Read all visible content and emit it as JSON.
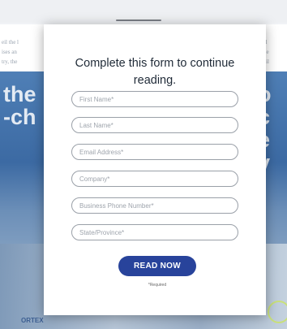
{
  "background": {
    "text_left": "eil the l\nises an\ntry, the",
    "text_right": "w sl\nlable\npabil",
    "headline_left": "the\n-ch",
    "headline_right": "o c\ne v",
    "logo_text": "ORTEX"
  },
  "modal": {
    "title": "Complete this form to continue reading.",
    "fields": [
      {
        "placeholder": "First Name*",
        "value": ""
      },
      {
        "placeholder": "Last Name*",
        "value": ""
      },
      {
        "placeholder": "Email Address*",
        "value": ""
      },
      {
        "placeholder": "Company*",
        "value": ""
      },
      {
        "placeholder": "Business Phone Number*",
        "value": ""
      },
      {
        "placeholder": "State/Province*",
        "value": ""
      }
    ],
    "submit_label": "READ NOW",
    "required_note": "*Required"
  },
  "colors": {
    "button": "#28439b",
    "field_border": "#9aa0a8",
    "background_blue": "#3c6aa3"
  }
}
